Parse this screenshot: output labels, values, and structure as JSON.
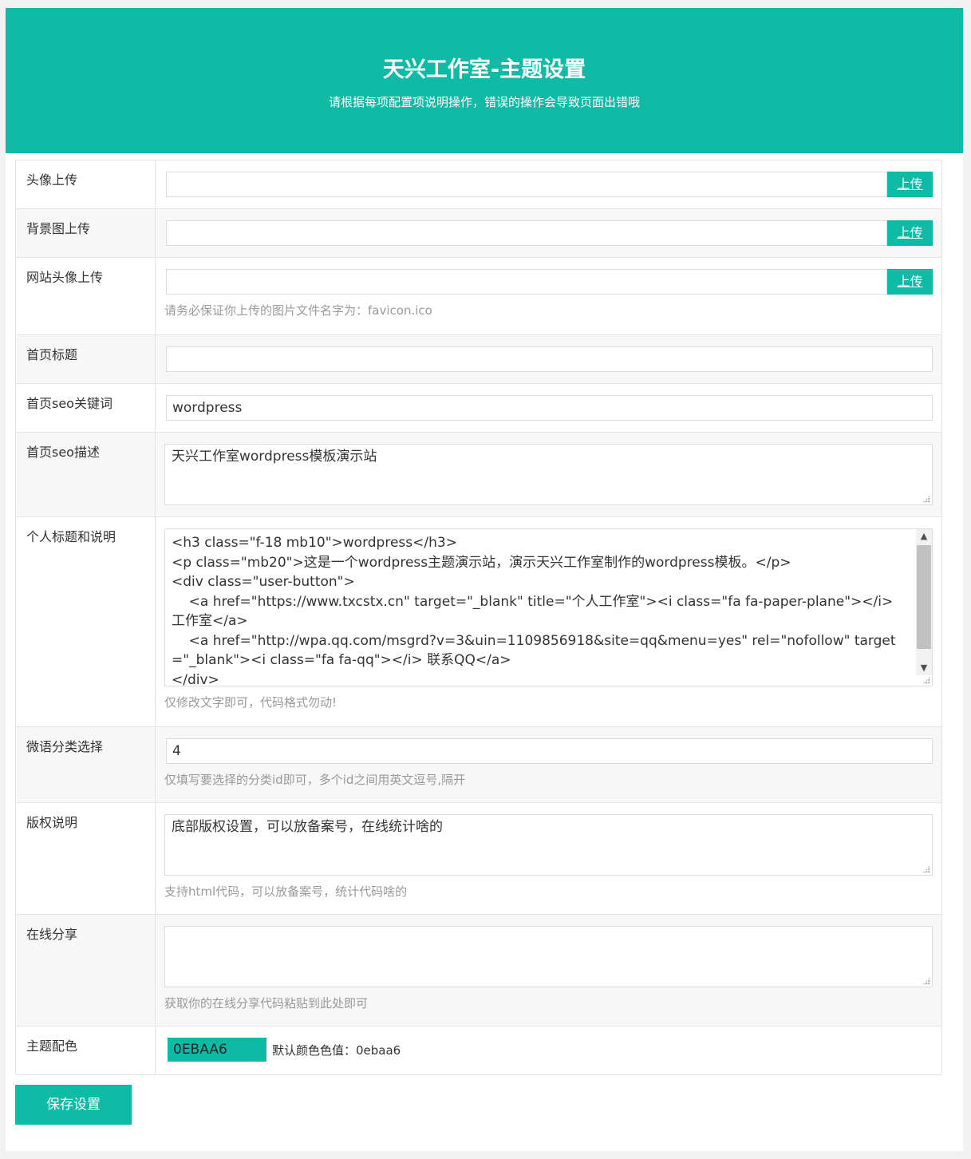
{
  "header": {
    "title": "天兴工作室-主题设置",
    "subtitle": "请根据每项配置项说明操作，错误的操作会导致页面出错哦"
  },
  "fields": {
    "avatar": {
      "label": "头像上传",
      "value": "",
      "button": "上传"
    },
    "background": {
      "label": "背景图上传",
      "value": "",
      "button": "上传"
    },
    "site_icon": {
      "label": "网站头像上传",
      "value": "",
      "button": "上传",
      "hint": "请务必保证你上传的图片文件名字为：favicon.ico"
    },
    "home_title": {
      "label": "首页标题",
      "value": ""
    },
    "seo_keywords": {
      "label": "首页seo关键词",
      "value": "wordpress"
    },
    "seo_description": {
      "label": "首页seo描述",
      "value": "天兴工作室wordpress模板演示站"
    },
    "personal": {
      "label": "个人标题和说明",
      "lines": [
        "<h3 class=\"f-18 mb10\">wordpress</h3>",
        "<p class=\"mb20\">这是一个wordpress主题演示站，演示天兴工作室制作的wordpress模板。</p>",
        "<div class=\"user-button\">",
        "    <a href=\"https://www.txcstx.cn\" target=\"_blank\" title=\"个人工作室\"><i class=\"fa fa-paper-plane\"></i> 工作室</a>",
        "    <a href=\"http://wpa.qq.com/msgrd?v=3&uin=1109856918&site=qq&menu=yes\" rel=\"nofollow\" target=\"_blank\"><i class=\"fa fa-qq\"></i> 联系QQ</a>",
        "</div>"
      ],
      "hint": "仅修改文字即可，代码格式勿动!"
    },
    "category": {
      "label": "微语分类选择",
      "value": "4",
      "hint": "仅填写要选择的分类id即可，多个id之间用英文逗号,隔开"
    },
    "copyright": {
      "label": "版权说明",
      "value": "底部版权设置，可以放备案号，在线统计啥的",
      "hint": "支持html代码，可以放备案号，统计代码啥的"
    },
    "share": {
      "label": "在线分享",
      "value": "",
      "hint": "获取你的在线分享代码粘贴到此处即可"
    },
    "theme_color": {
      "label": "主题配色",
      "value": "0EBAA6",
      "note": "默认颜色色值：0ebaa6",
      "swatch": "#0ebaa6"
    }
  },
  "save_button": "保存设置",
  "colors": {
    "accent": "#10bba6",
    "background": "#f1f1f1"
  }
}
